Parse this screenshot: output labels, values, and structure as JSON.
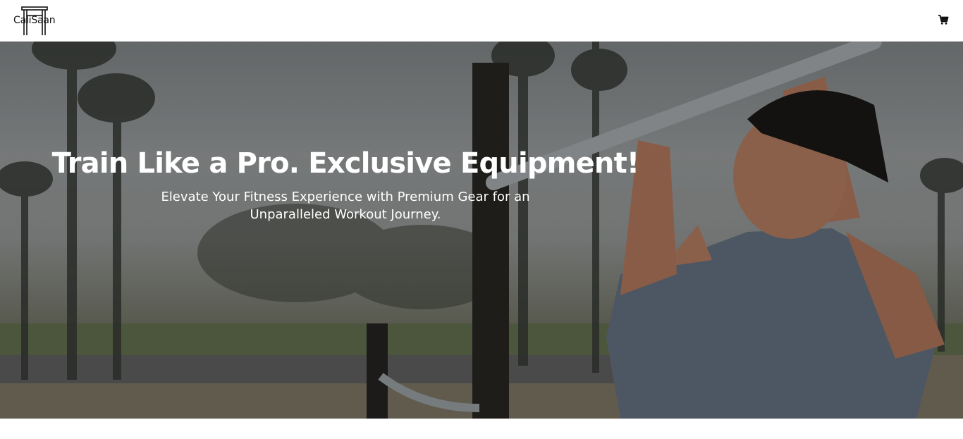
{
  "header": {
    "logo_text": "CaliSaan",
    "logo_icon": "pull-up-bar-logo",
    "cart_icon": "shopping-cart-icon"
  },
  "hero": {
    "title": "Train Like a Pro. Exclusive Equipment!",
    "subtitle": "Elevate Your Fitness Experience with Premium Gear for an Unparalleled Workout Journey.",
    "overlay_color": "#000000"
  }
}
